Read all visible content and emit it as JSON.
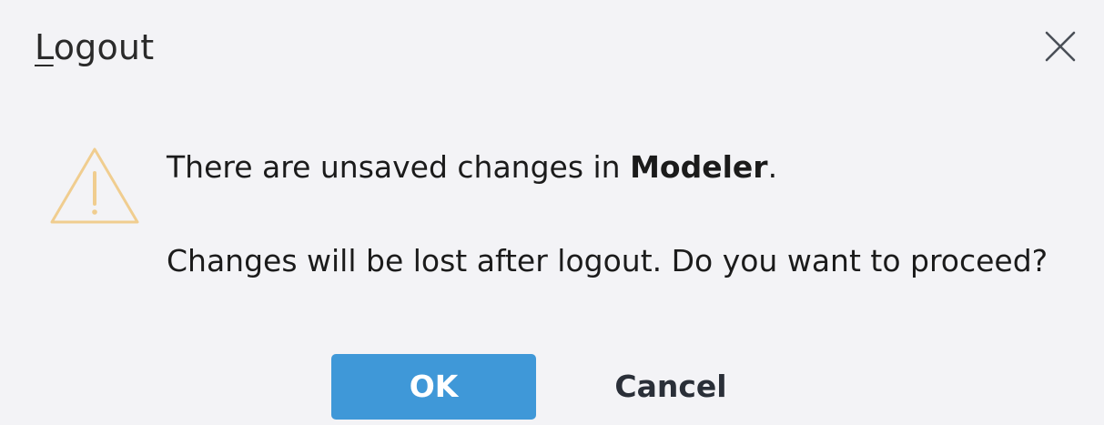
{
  "dialog": {
    "title_mnemonic": "L",
    "title_rest": "ogout",
    "message_prefix": "There are unsaved changes in ",
    "message_app": "Modeler",
    "message_suffix": ".",
    "message_line2": "Changes will be lost after logout. Do you want to proceed?",
    "ok_label": "OK",
    "cancel_label": "Cancel"
  },
  "icons": {
    "warning": "warning-triangle-icon",
    "close": "close-icon"
  },
  "colors": {
    "background": "#f3f3f6",
    "primary_button": "#3f98d8",
    "warning_icon": "#f0cd8f"
  }
}
